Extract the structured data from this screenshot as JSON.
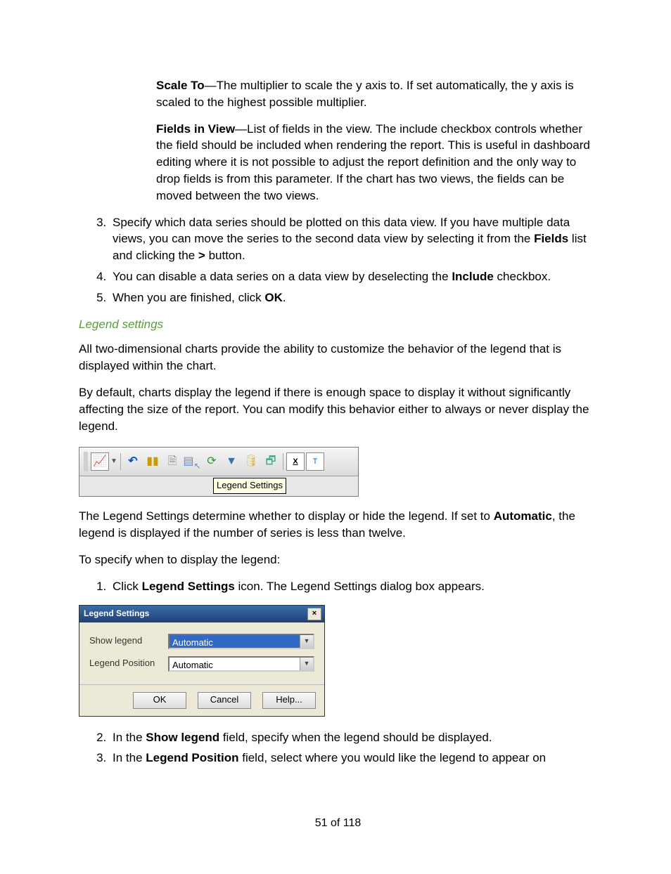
{
  "def1": {
    "term": "Scale To",
    "sep": "—",
    "text": "The multiplier to scale the y axis to. If set automatically, the y axis is scaled to the highest possible multiplier."
  },
  "def2": {
    "term": "Fields in View",
    "sep": "—",
    "text": "List of fields in the view. The include checkbox controls whether the field should be included when rendering the report. This is useful in dashboard editing where it is not possible to adjust the report definition and the only way to drop fields is from this parameter. If the chart has two views, the fields can be moved between the two views."
  },
  "list1": {
    "start": 3,
    "item3_a": "Specify which data series should be plotted on this data view. If you have multiple data views, you can move the series to the second data view by selecting it from the ",
    "item3_b": "Fields",
    "item3_c": " list and clicking the ",
    "item3_d": ">",
    "item3_e": " button.",
    "item4_a": "You can disable a data series on a data view by deselecting the ",
    "item4_b": "Include",
    "item4_c": " checkbox.",
    "item5_a": "When you are finished, click ",
    "item5_b": "OK",
    "item5_c": "."
  },
  "heading": "Legend settings",
  "para1": "All two-dimensional charts provide the ability to customize the behavior of the legend that is displayed within the chart.",
  "para2": "By default, charts display the legend if there is enough space to display it without significantly affecting the size of the report. You can modify this behavior either to always or never display the legend.",
  "toolbar": {
    "tooltip": "Legend Settings"
  },
  "para3_a": "The Legend Settings determine whether to display or hide the legend. If set to ",
  "para3_b": "Automatic",
  "para3_c": ", the legend is displayed if the number of series is less than twelve.",
  "para4": "To specify when to display the legend:",
  "list2": {
    "item1_a": "Click ",
    "item1_b": "Legend Settings",
    "item1_c": " icon. The Legend Settings dialog box appears.",
    "item2_a": "In the ",
    "item2_b": "Show legend",
    "item2_c": " field, specify when the legend should be displayed.",
    "item3_a": "In the ",
    "item3_b": "Legend Position",
    "item3_c": " field, select where you would like the legend to appear on"
  },
  "dialog": {
    "title": "Legend Settings",
    "close": "×",
    "row1_label": "Show legend",
    "row1_value": "Automatic",
    "row2_label": "Legend Position",
    "row2_value": "Automatic",
    "ok": "OK",
    "cancel": "Cancel",
    "help": "Help..."
  },
  "pagenum": "51 of 118"
}
